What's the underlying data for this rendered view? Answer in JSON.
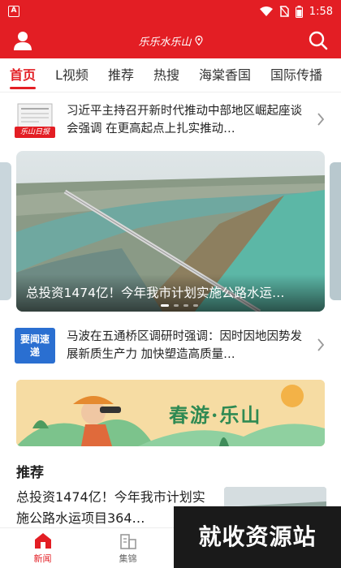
{
  "status_bar": {
    "time": "1:58",
    "app_badge": "A"
  },
  "header": {
    "logo_text": "乐乐水乐山"
  },
  "tabs": [
    {
      "label": "首页"
    },
    {
      "label": "L视频"
    },
    {
      "label": "推荐"
    },
    {
      "label": "热搜"
    },
    {
      "label": "海棠香国"
    },
    {
      "label": "国际传播"
    }
  ],
  "news": [
    {
      "text": "习近平主持召开新时代推动中部地区崛起座谈会强调 在更高起点上扎实推动…",
      "thumb_label": "乐山日报"
    },
    {
      "text": "马波在五通桥区调研时强调：因时因地因势发展新质生产力 加快塑造高质量…",
      "thumb_label": "要闻速递"
    }
  ],
  "carousel": {
    "caption": "总投资1474亿！今年我市计划实施公路水运…"
  },
  "banner": {
    "text": "春游·乐山"
  },
  "recommend": {
    "title": "推荐",
    "item_text": "总投资1474亿！今年我市计划实施公路水运项目364…"
  },
  "bottom_nav": [
    {
      "label": "新闻"
    },
    {
      "label": "集锦"
    }
  ],
  "watermark": {
    "text": "就收资源站"
  },
  "colors": {
    "brand": "#e31e24"
  }
}
